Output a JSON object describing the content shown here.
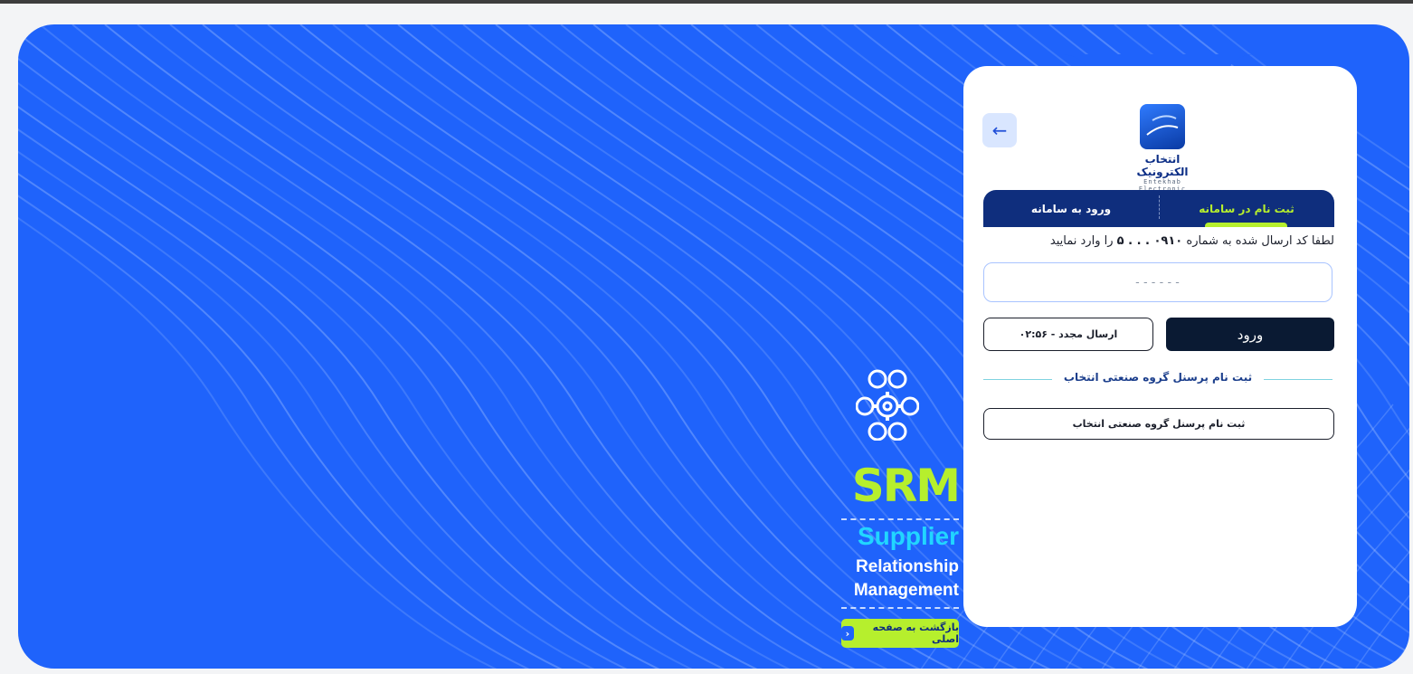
{
  "colors": {
    "hero_blue": "#1f63fb",
    "navy": "#0f2e7d",
    "lime": "#b6ef2d",
    "cyan": "#21d6ff",
    "button_dark": "#0a1a33"
  },
  "branding": {
    "srm": "SRM",
    "supplier": "Supplier",
    "relationship": "Relationship",
    "management": "Management",
    "back_home_label": "بازگشت به صفحه اصلی"
  },
  "card": {
    "logo_text_fa": "انتخاب الکترونیک",
    "logo_text_en": "Entekhab Electronic",
    "tabs": [
      {
        "label": "ثبت نام در سامانه",
        "active": true
      },
      {
        "label": "ورود به سامانه",
        "active": false
      }
    ],
    "instruction_before": "لطفا کد ارسال شده به شماره",
    "instruction_phone": "۰۹۱۰ . . . ۵",
    "instruction_after": "را وارد نمایید",
    "otp_placeholder": "------",
    "login_button": "ورود",
    "resend_button": "ارسال مجدد - ۰۲:۵۶",
    "section_title": "ثبت نام پرسنل گروه صنعتی انتخاب",
    "staff_register_button": "ثبت نام پرسنل گروه صنعتی انتخاب"
  },
  "icons": {
    "back": "arrow-left-icon",
    "srm_people": "people-gear-icon",
    "chevron": "chevron-right-icon",
    "logo": "entekhab-logo-icon"
  }
}
